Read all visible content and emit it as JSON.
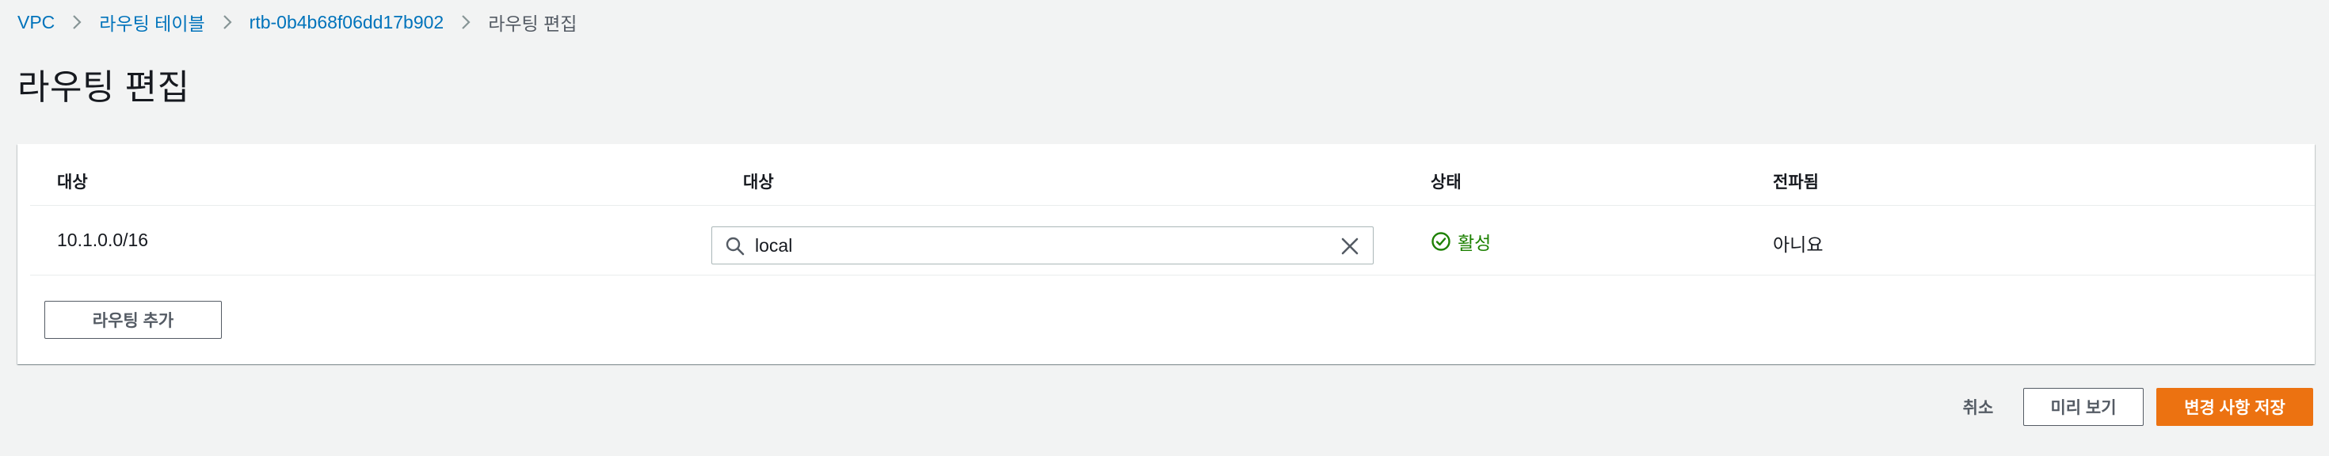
{
  "breadcrumb": [
    {
      "label": "VPC"
    },
    {
      "label": "라우팅 테이블"
    },
    {
      "label": "rtb-0b4b68f06dd17b902"
    },
    {
      "label": "라우팅 편집"
    }
  ],
  "page": {
    "title": "라우팅 편집"
  },
  "table": {
    "headers": [
      "대상",
      "대상",
      "상태",
      "전파됨"
    ],
    "rows": [
      {
        "destination": "10.1.0.0/16",
        "target": "local",
        "status": "활성",
        "propagated": "아니요"
      }
    ],
    "add_route_label": "라우팅 추가"
  },
  "actions": {
    "cancel_label": "취소",
    "preview_label": "미리 보기",
    "save_label": "변경 사항 저장"
  },
  "colors": {
    "link": "#0073bb",
    "success": "#1d8102",
    "primary": "#ec7211",
    "background": "#f2f3f3"
  },
  "icons": {
    "breadcrumb_separator": "chevron-right-icon",
    "search": "search-icon",
    "clear": "close-icon",
    "status": "check-circle-icon"
  }
}
